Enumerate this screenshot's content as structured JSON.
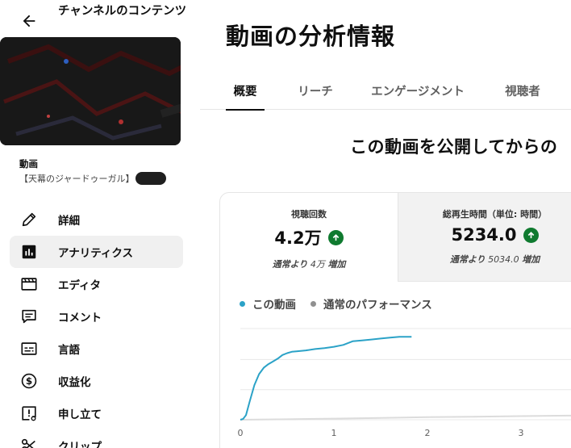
{
  "sidebar": {
    "title": "チャンネルのコンテンツ",
    "video_section_label": "動画",
    "video_title": "【天幕のジャードゥーガル】",
    "items": [
      {
        "label": "詳細",
        "icon": "pencil-icon",
        "active": false
      },
      {
        "label": "アナリティクス",
        "icon": "analytics-icon",
        "active": true
      },
      {
        "label": "エディタ",
        "icon": "film-editor-icon",
        "active": false
      },
      {
        "label": "コメント",
        "icon": "comment-icon",
        "active": false
      },
      {
        "label": "言語",
        "icon": "subtitles-icon",
        "active": false
      },
      {
        "label": "収益化",
        "icon": "dollar-icon",
        "active": false
      },
      {
        "label": "申し立て",
        "icon": "copyright-claim-icon",
        "active": false
      },
      {
        "label": "クリップ",
        "icon": "scissors-icon",
        "active": false
      }
    ]
  },
  "main": {
    "page_title": "動画の分析情報",
    "tabs": [
      {
        "label": "概要",
        "active": true
      },
      {
        "label": "リーチ",
        "active": false
      },
      {
        "label": "エンゲージメント",
        "active": false
      },
      {
        "label": "視聴者",
        "active": false
      }
    ],
    "section_heading": "この動画を公開してからの",
    "metrics": [
      {
        "label": "視聴回数",
        "value": "4.2万",
        "compare_prefix": "通常より",
        "compare_amount": "4万",
        "compare_suffix": "増加",
        "trend": "up"
      },
      {
        "label": "総再生時間（単位: 時間）",
        "value": "5234.0",
        "compare_prefix": "通常より",
        "compare_amount": "5034.0",
        "compare_suffix": "増加",
        "trend": "up"
      }
    ],
    "legend": [
      {
        "label": "この動画",
        "color": "#2ba2c7"
      },
      {
        "label": "通常のパフォーマンス",
        "color": "#909090"
      }
    ]
  },
  "chart_data": {
    "type": "line",
    "x_ticks": [
      "0",
      "1",
      "2",
      "3"
    ],
    "xlim": [
      0,
      3.75
    ],
    "ylim": [
      0,
      1
    ],
    "grid": true,
    "series": [
      {
        "name": "この動画",
        "color": "#2ba2c7",
        "x": [
          0,
          0.03,
          0.06,
          0.1,
          0.15,
          0.2,
          0.25,
          0.3,
          0.35,
          0.4,
          0.45,
          0.5,
          0.55,
          0.6,
          0.7,
          0.8,
          0.9,
          1.0,
          1.1,
          1.2,
          1.3,
          1.4,
          1.5,
          1.6,
          1.7,
          1.8,
          1.83
        ],
        "y": [
          0,
          0.01,
          0.05,
          0.2,
          0.38,
          0.5,
          0.57,
          0.61,
          0.64,
          0.67,
          0.71,
          0.73,
          0.745,
          0.75,
          0.76,
          0.775,
          0.785,
          0.8,
          0.82,
          0.86,
          0.87,
          0.88,
          0.89,
          0.9,
          0.91,
          0.91,
          0.91
        ]
      },
      {
        "name": "通常のパフォーマンス",
        "color": "#dcdcdc",
        "x": [
          0,
          0.5,
          1.0,
          1.5,
          2.0,
          2.5,
          3.0,
          3.5,
          3.75
        ],
        "y": [
          0,
          0.005,
          0.012,
          0.02,
          0.028,
          0.034,
          0.04,
          0.045,
          0.047
        ]
      }
    ]
  }
}
